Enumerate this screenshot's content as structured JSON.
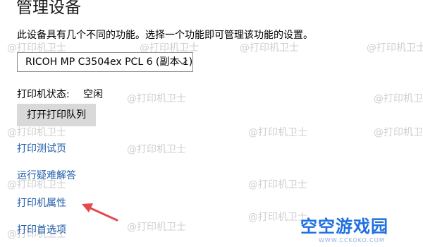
{
  "page": {
    "title": "管理设备",
    "description": "此设备具有几个不同的功能。选择一个功能即可管理该功能的设置。"
  },
  "device_select": {
    "selected": "RICOH MP C3504ex PCL 6 (副本 1)"
  },
  "status": {
    "label": "打印机状态:",
    "value": "空闲"
  },
  "actions": {
    "open_queue": "打开打印队列",
    "test_page": "打印测试页",
    "troubleshoot": "运行疑难解答",
    "printer_properties": "打印机属性",
    "printing_preferences": "打印首选项"
  },
  "watermark": {
    "text": "@打印机卫士"
  },
  "branding": {
    "logo_text": "空空游戏园",
    "logo_domain": "WWW.CCKOKO.COM"
  },
  "colors": {
    "link": "#1d5ba8",
    "arrow": "#e5484d",
    "button_bg": "#d9d9d9",
    "logo": "#1f6fe0"
  }
}
